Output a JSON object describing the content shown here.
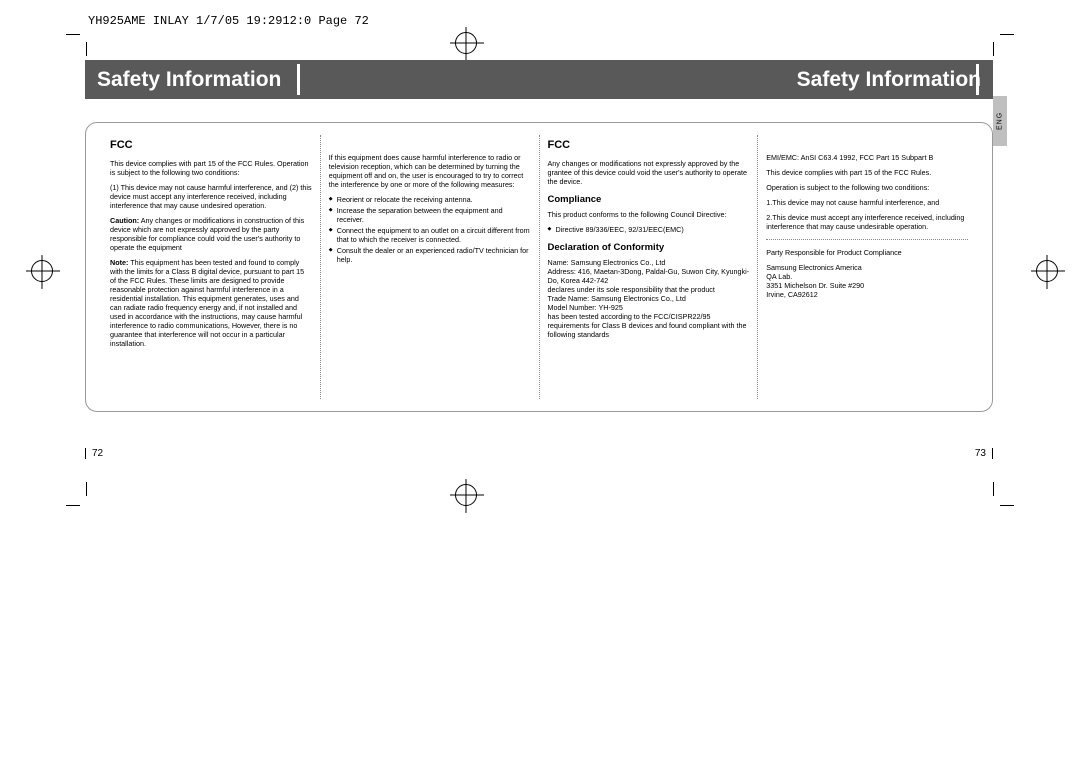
{
  "printMeta": "YH925AME INLAY  1/7/05 19:2912:0  Page 72",
  "leftPage": {
    "banner": "Safety Information",
    "fccHeading": "FCC",
    "p1": "This device complies with part 15 of the FCC Rules. Operation is subject to the following two conditions:",
    "p2": "(1) This device may not cause harmful interference, and (2) this device must accept any interference received, including interference that may cause undesired operation.",
    "cautionLabel": "Caution:",
    "caution": "Any changes or modifications in construction of this device which are not expressly approved by the party responsible for compliance could void the user's authority to operate the equipment",
    "noteLabel": "Note:",
    "note": "This equipment has been tested and found to comply with the limits for a Class B digital device, pursuant to part 15 of the FCC Rules. These limits are designed to provide reasonable protection against harmful interference in a residential installation. This equipment generates, uses and can radiate radio frequency energy and, if not installed and used in accordance with the instructions, may cause harmful interference to radio communications, However, there is no guarantee that interference will not occur in a particular installation.",
    "col2Intro": "If this equipment does cause harmful interference to radio or television reception, which can be determined by turning the equipment off and on, the user is encouraged to try to correct the interference by one or more of the following measures:",
    "measures": [
      "Reorient or relocate the receiving antenna.",
      "Increase the separation between the equipment and receiver.",
      "Connect the equipment to an outlet on a circuit different from that to which the receiver is connected.",
      "Consult the dealer or an experienced radio/TV technician for help."
    ],
    "pageNumber": "72"
  },
  "rightPage": {
    "banner": "Safety Information",
    "fccHeading": "FCC",
    "fccBody": "Any changes or modifications not expressly approved by the grantee of this device could void the user's authority to operate the device.",
    "complianceHeading": "Compliance",
    "complianceBody": "This product conforms to the following Council Directive:",
    "complianceBullet": "Directive 89/336/EEC, 92/31/EEC(EMC)",
    "declHeading": "Declaration of Conformity",
    "declBody": "Name: Samsung Electronics Co., Ltd\nAddress: 416, Maetan-3Dong, Paldal-Gu, Suwon City, Kyungki-Do, Korea 442-742\ndeclares under its sole responsibility that the product\nTrade Name: Samsung Electronics Co., Ltd\nModel Number: YH-925\nhas been tested according to the FCC/CISPR22/95 requirements for Class B devices and found compliant with the following standards",
    "emi": "EMI/EMC: AnSI C63.4 1992, FCC Part 15 Subpart B",
    "rules": "This device complies with part 15 of the FCC Rules.",
    "opCond": "Operation is subject to the following two conditions:",
    "cond1": "1.This device may not cause harmful interference, and",
    "cond2": "2.This device must accept any interference received, including interference that may cause undesirable operation.",
    "partyLabel": "Party Responsible for Product Compliance",
    "party": "Samsung Electronics America\nQA Lab.\n3351 Michelson Dr. Suite #290\nIrvine, CA92612",
    "pageNumber": "73"
  },
  "langTab": "ENG"
}
